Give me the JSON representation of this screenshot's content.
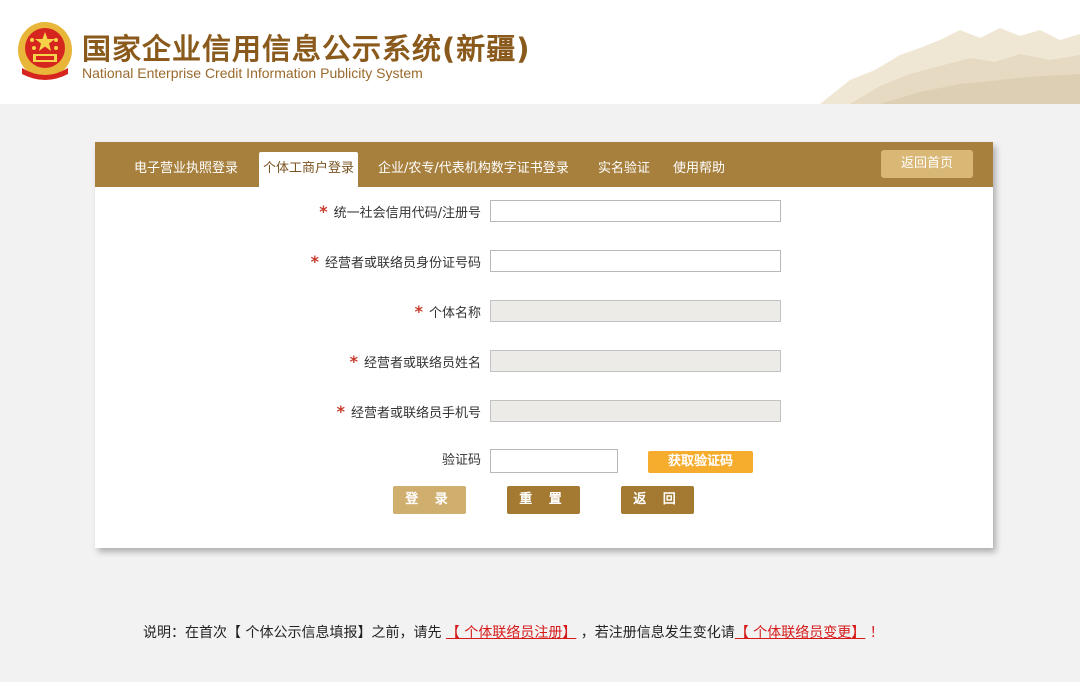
{
  "header": {
    "title_cn": "国家企业信用信息公示系统(新疆)",
    "title_en": "National Enterprise Credit Information Publicity System"
  },
  "tabs": [
    {
      "label": "电子营业执照登录",
      "active": false
    },
    {
      "label": "个体工商户登录",
      "active": true
    },
    {
      "label": "企业/农专/代表机构数字证书登录",
      "active": false
    },
    {
      "label": "实名验证",
      "active": false
    },
    {
      "label": "使用帮助",
      "active": false
    }
  ],
  "home_button": "返回首页",
  "form": {
    "required_mark": "*",
    "fields": [
      {
        "label": "统一社会信用代码/注册号",
        "value": "",
        "disabled": false,
        "required": true
      },
      {
        "label": "经营者或联络员身份证号码",
        "value": "",
        "disabled": false,
        "required": true
      },
      {
        "label": "个体名称",
        "value": "",
        "disabled": true,
        "required": true
      },
      {
        "label": "经营者或联络员姓名",
        "value": "",
        "disabled": true,
        "required": true
      },
      {
        "label": "经营者或联络员手机号",
        "value": "",
        "disabled": true,
        "required": true
      }
    ],
    "captcha_label": "验证码",
    "captcha_value": "",
    "get_code_button": "获取验证码",
    "login_button": "登 录",
    "reset_button": "重 置",
    "back_button": "返 回"
  },
  "note": {
    "prefix": "说明：在首次【 个体公示信息填报】之前，请先 ",
    "link1": "【 个体联络员注册】",
    "middle": " ，若注册信息发生变化请",
    "link2": "【 个体联络员变更】",
    "suffix": " ！"
  },
  "colors": {
    "brand_gold": "#a7803e",
    "title_brown": "#8a5a1c",
    "accent_orange": "#f6ad2d",
    "required_red": "#c83a2a",
    "link_red": "#d61a1a"
  }
}
